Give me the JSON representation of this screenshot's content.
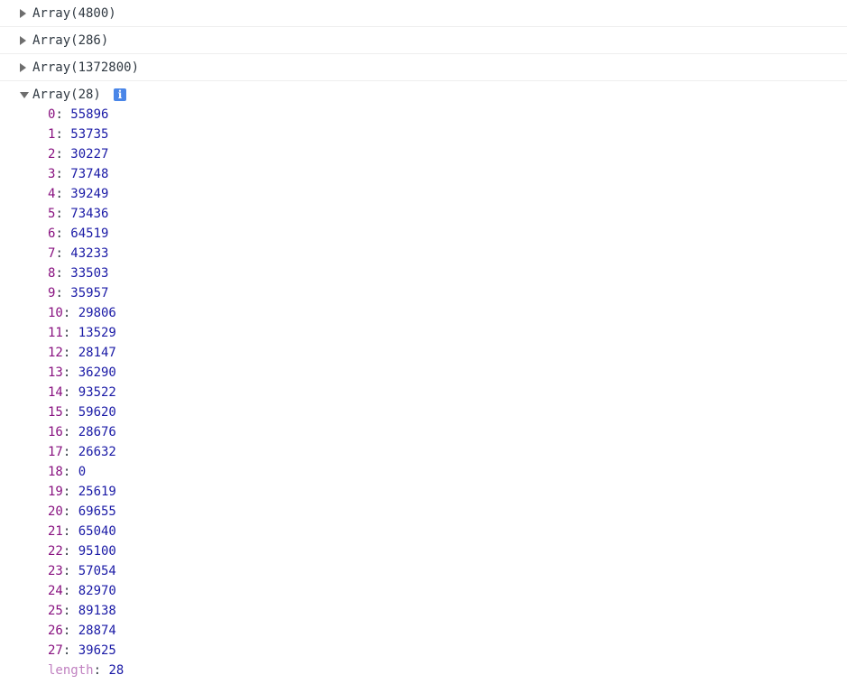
{
  "log_rows": [
    {
      "label": "Array(4800)"
    },
    {
      "label": "Array(286)"
    },
    {
      "label": "Array(1372800)"
    }
  ],
  "expanded": {
    "label": "Array(28)",
    "info_glyph": "i",
    "entries": [
      {
        "key": "0",
        "value": "55896"
      },
      {
        "key": "1",
        "value": "53735"
      },
      {
        "key": "2",
        "value": "30227"
      },
      {
        "key": "3",
        "value": "73748"
      },
      {
        "key": "4",
        "value": "39249"
      },
      {
        "key": "5",
        "value": "73436"
      },
      {
        "key": "6",
        "value": "64519"
      },
      {
        "key": "7",
        "value": "43233"
      },
      {
        "key": "8",
        "value": "33503"
      },
      {
        "key": "9",
        "value": "35957"
      },
      {
        "key": "10",
        "value": "29806"
      },
      {
        "key": "11",
        "value": "13529"
      },
      {
        "key": "12",
        "value": "28147"
      },
      {
        "key": "13",
        "value": "36290"
      },
      {
        "key": "14",
        "value": "93522"
      },
      {
        "key": "15",
        "value": "59620"
      },
      {
        "key": "16",
        "value": "28676"
      },
      {
        "key": "17",
        "value": "26632"
      },
      {
        "key": "18",
        "value": "0"
      },
      {
        "key": "19",
        "value": "25619"
      },
      {
        "key": "20",
        "value": "69655"
      },
      {
        "key": "21",
        "value": "65040"
      },
      {
        "key": "22",
        "value": "95100"
      },
      {
        "key": "23",
        "value": "57054"
      },
      {
        "key": "24",
        "value": "82970"
      },
      {
        "key": "25",
        "value": "89138"
      },
      {
        "key": "26",
        "value": "28874"
      },
      {
        "key": "27",
        "value": "39625"
      }
    ],
    "length_key": "length",
    "length_value": "28"
  },
  "colors": {
    "key": "#881280",
    "value": "#1a1aa6",
    "info_badge": "#4a86e8"
  },
  "icons": {
    "collapsed": "triangle-right-icon",
    "expanded": "triangle-down-icon",
    "info": "info-icon"
  }
}
